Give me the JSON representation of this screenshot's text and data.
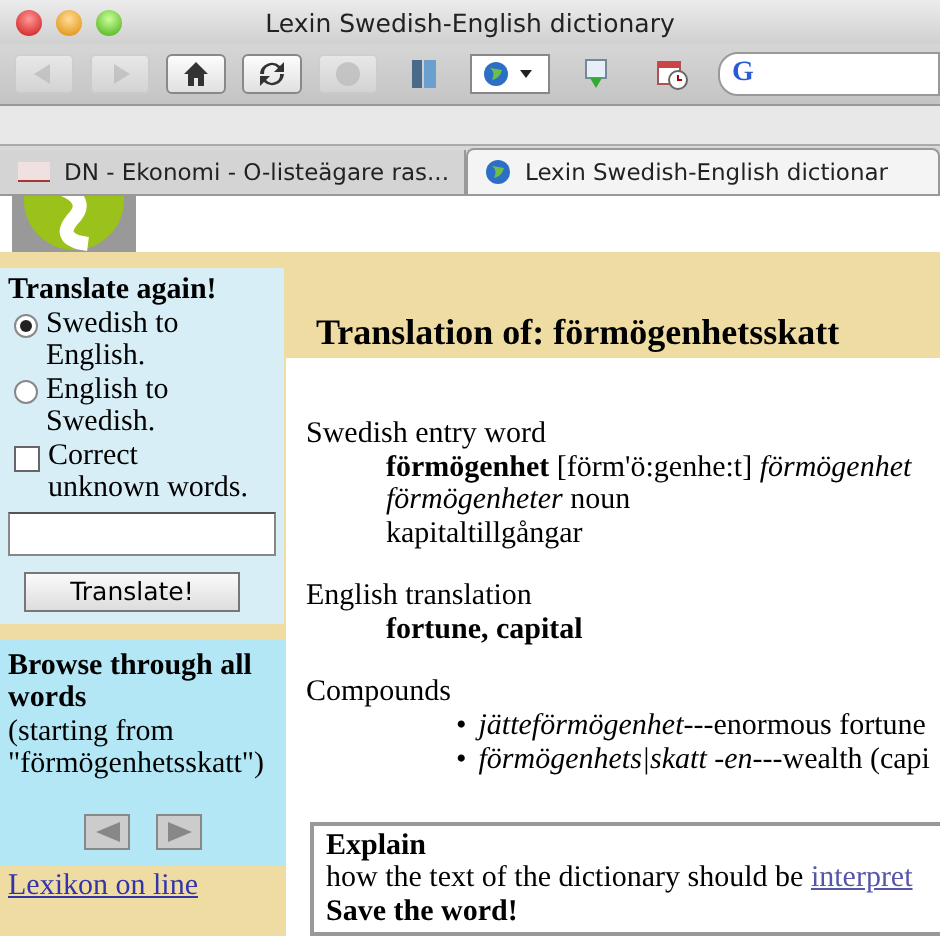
{
  "window": {
    "title": "Lexin Swedish-English dictionary"
  },
  "toolbar": [
    {
      "kind": "back",
      "disabled": true
    },
    {
      "kind": "forward",
      "disabled": true
    },
    {
      "kind": "home",
      "disabled": false
    },
    {
      "kind": "reload",
      "disabled": false
    },
    {
      "kind": "stop",
      "disabled": true
    },
    {
      "kind": "bookmarks"
    },
    {
      "kind": "globe-menu"
    },
    {
      "kind": "download"
    },
    {
      "kind": "calendar"
    },
    {
      "kind": "search",
      "label": "G"
    }
  ],
  "tabs": [
    {
      "label": "DN - Ekonomi - O-listeägare ras...",
      "selected": false
    },
    {
      "label": "Lexin Swedish-English dictionar",
      "selected": true
    }
  ],
  "sidebar": {
    "translate": {
      "heading": "Translate again!",
      "options": [
        {
          "label": "Swedish to English.",
          "selected": true
        },
        {
          "label": "English to Swedish.",
          "selected": false
        }
      ],
      "checkbox": {
        "label": "Correct unknown words.",
        "checked": false
      },
      "button": "Translate!"
    },
    "browse": {
      "heading": "Browse through all words",
      "subtitle": "(starting from \"förmögenhetsskatt\")"
    },
    "link": "Lexikon on line"
  },
  "main": {
    "heading": "Translation of: förmögenhetsskatt",
    "sections": [
      {
        "label": "Swedish entry word",
        "lines": [
          "**förmögenhet** [förm'ö:genhe:t] *förmögenhet*",
          "*förmögenheter* noun",
          "kapitaltillgångar"
        ],
        "bold": false
      },
      {
        "label": "English translation",
        "lines": [
          "fortune, capital"
        ],
        "bold": true
      },
      {
        "label": "Compounds",
        "bullets": [
          {
            "marker": "•",
            "text": "*jätteförmögenhet*---enormous fortune"
          },
          {
            "marker": "•",
            "text": "*förmögenhets|skatt -en*---wealth (capi"
          }
        ]
      }
    ],
    "explain": {
      "heading": "Explain",
      "text": "how the text of the dictionary should be ",
      "link": "interpret",
      "save": "Save the word!"
    }
  }
}
